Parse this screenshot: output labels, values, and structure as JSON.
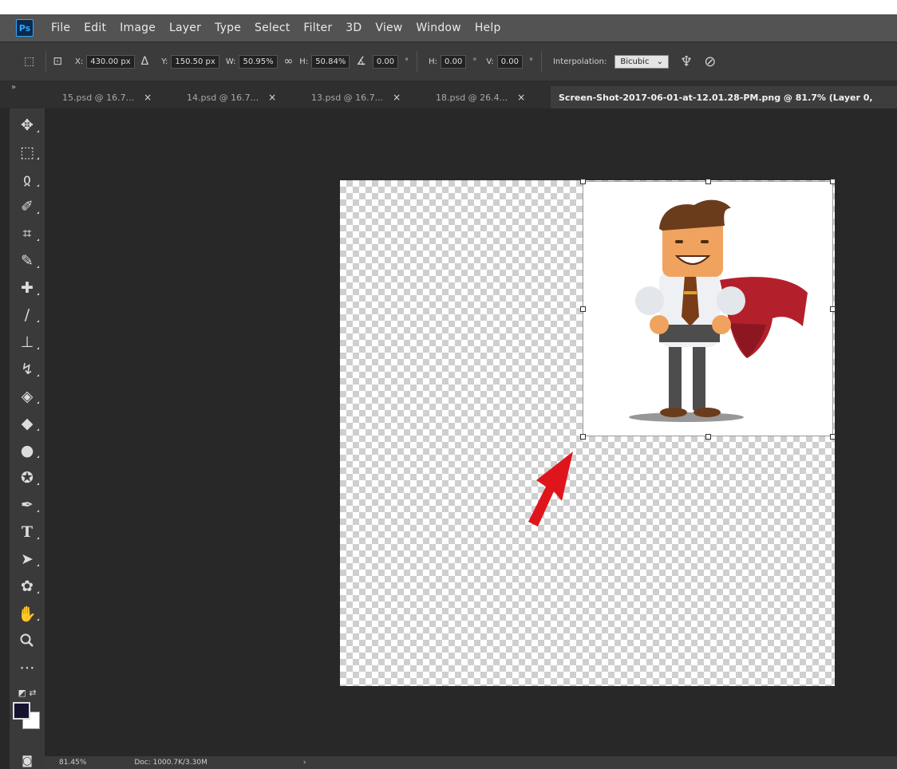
{
  "app": {
    "logo_text": "Ps"
  },
  "menu": [
    "File",
    "Edit",
    "Image",
    "Layer",
    "Type",
    "Select",
    "Filter",
    "3D",
    "View",
    "Window",
    "Help"
  ],
  "options": {
    "x_label": "X:",
    "x_value": "430.00 px",
    "y_label": "Y:",
    "y_value": "150.50 px",
    "w_label": "W:",
    "w_value": "50.95%",
    "h_label": "H:",
    "h_value": "50.84%",
    "angle_value": "0.00",
    "angle_unit": "°",
    "hskew_label": "H:",
    "hskew_value": "0.00",
    "vskew_label": "V:",
    "vskew_value": "0.00",
    "interp_label": "Interpolation:",
    "interp_value": "Bicubic",
    "dropdown_arrow": "⌄",
    "link_glyph": "∞",
    "delta_glyph": "Δ"
  },
  "tabs": [
    {
      "label": "15.psd @ 16.7...",
      "close": "×"
    },
    {
      "label": "14.psd @ 16.7...",
      "close": "×"
    },
    {
      "label": "13.psd @ 16.7...",
      "close": "×"
    },
    {
      "label": "18.psd @ 26.4...",
      "close": "×"
    },
    {
      "label": "Screen-Shot-2017-06-01-at-12.01.28-PM.png @ 81.7% (Layer 0,",
      "active": true
    }
  ],
  "tabbar_collapse": "»",
  "tools": [
    {
      "name": "move-tool",
      "glyph": "✥"
    },
    {
      "name": "marquee-tool",
      "glyph": "⬚"
    },
    {
      "name": "lasso-tool",
      "glyph": "ჲ"
    },
    {
      "name": "magic-wand-tool",
      "glyph": "✐"
    },
    {
      "name": "crop-tool",
      "glyph": "⌗"
    },
    {
      "name": "eyedropper-tool",
      "glyph": "✎"
    },
    {
      "name": "healing-brush-tool",
      "glyph": "✚"
    },
    {
      "name": "brush-tool",
      "glyph": "∕"
    },
    {
      "name": "clone-stamp-tool",
      "glyph": "⊥"
    },
    {
      "name": "history-brush-tool",
      "glyph": "↯"
    },
    {
      "name": "eraser-tool",
      "glyph": "◈"
    },
    {
      "name": "paint-bucket-tool",
      "glyph": "◆"
    },
    {
      "name": "blur-tool",
      "glyph": "●"
    },
    {
      "name": "dodge-tool",
      "glyph": "✪"
    },
    {
      "name": "pen-tool",
      "glyph": "✒"
    },
    {
      "name": "type-tool",
      "glyph": "T"
    },
    {
      "name": "path-selection-tool",
      "glyph": "➤"
    },
    {
      "name": "shape-tool",
      "glyph": "✿"
    },
    {
      "name": "hand-tool",
      "glyph": "✋"
    },
    {
      "name": "zoom-tool",
      "glyph": "🔍"
    },
    {
      "name": "more-tools",
      "glyph": "⋯"
    }
  ],
  "colors": {
    "foreground": "#14142e",
    "background": "#ffffff",
    "arrow": "#e0151c",
    "cape": "#b3202b"
  },
  "status": {
    "zoom": "81.45%",
    "doc": "Doc: 1000.7K/3.30M",
    "arrow": "›"
  }
}
